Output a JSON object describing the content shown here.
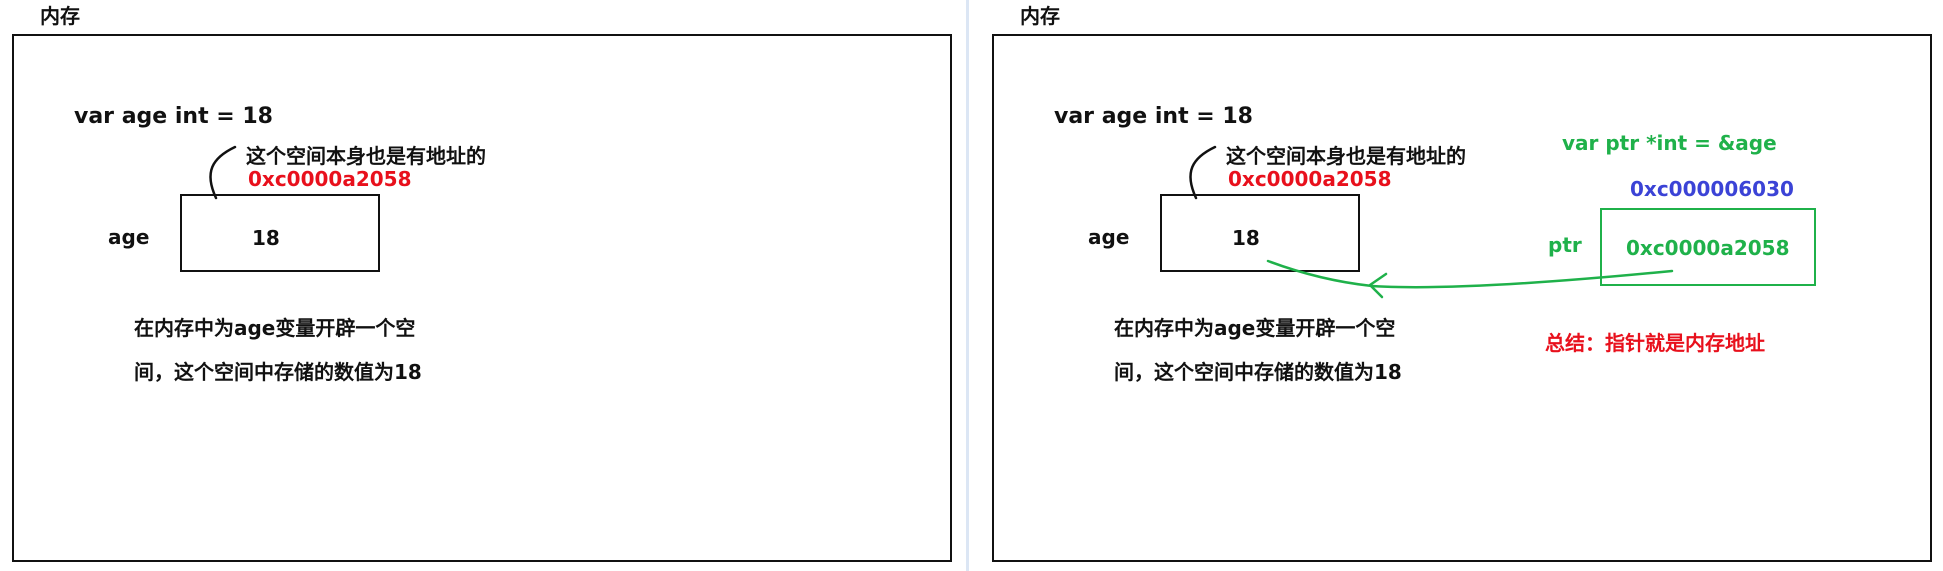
{
  "left_panel": {
    "title": "内存",
    "declaration": "var age int = 18",
    "address_note": "这个空间本身也是有地址的",
    "address": "0xc0000a2058",
    "variable_label": "age",
    "value": "18",
    "description_line1": "在内存中为age变量开辟一个空",
    "description_line2": "间，这个空间中存储的数值为18"
  },
  "right_panel": {
    "title": "内存",
    "declaration": "var age int = 18",
    "address_note": "这个空间本身也是有地址的",
    "address": "0xc0000a2058",
    "variable_label": "age",
    "value": "18",
    "description_line1": "在内存中为age变量开辟一个空",
    "description_line2": "间，这个空间中存储的数值为18",
    "ptr_declaration": "var ptr *int = &age",
    "ptr_address": "0xc000006030",
    "ptr_label": "ptr",
    "ptr_value": "0xc0000a2058",
    "summary": "总结：指针就是内存地址"
  },
  "colors": {
    "address_red": "#e8101c",
    "pointer_green": "#1fb14a",
    "pointer_address_blue": "#3b43d6",
    "ink": "#111111"
  }
}
